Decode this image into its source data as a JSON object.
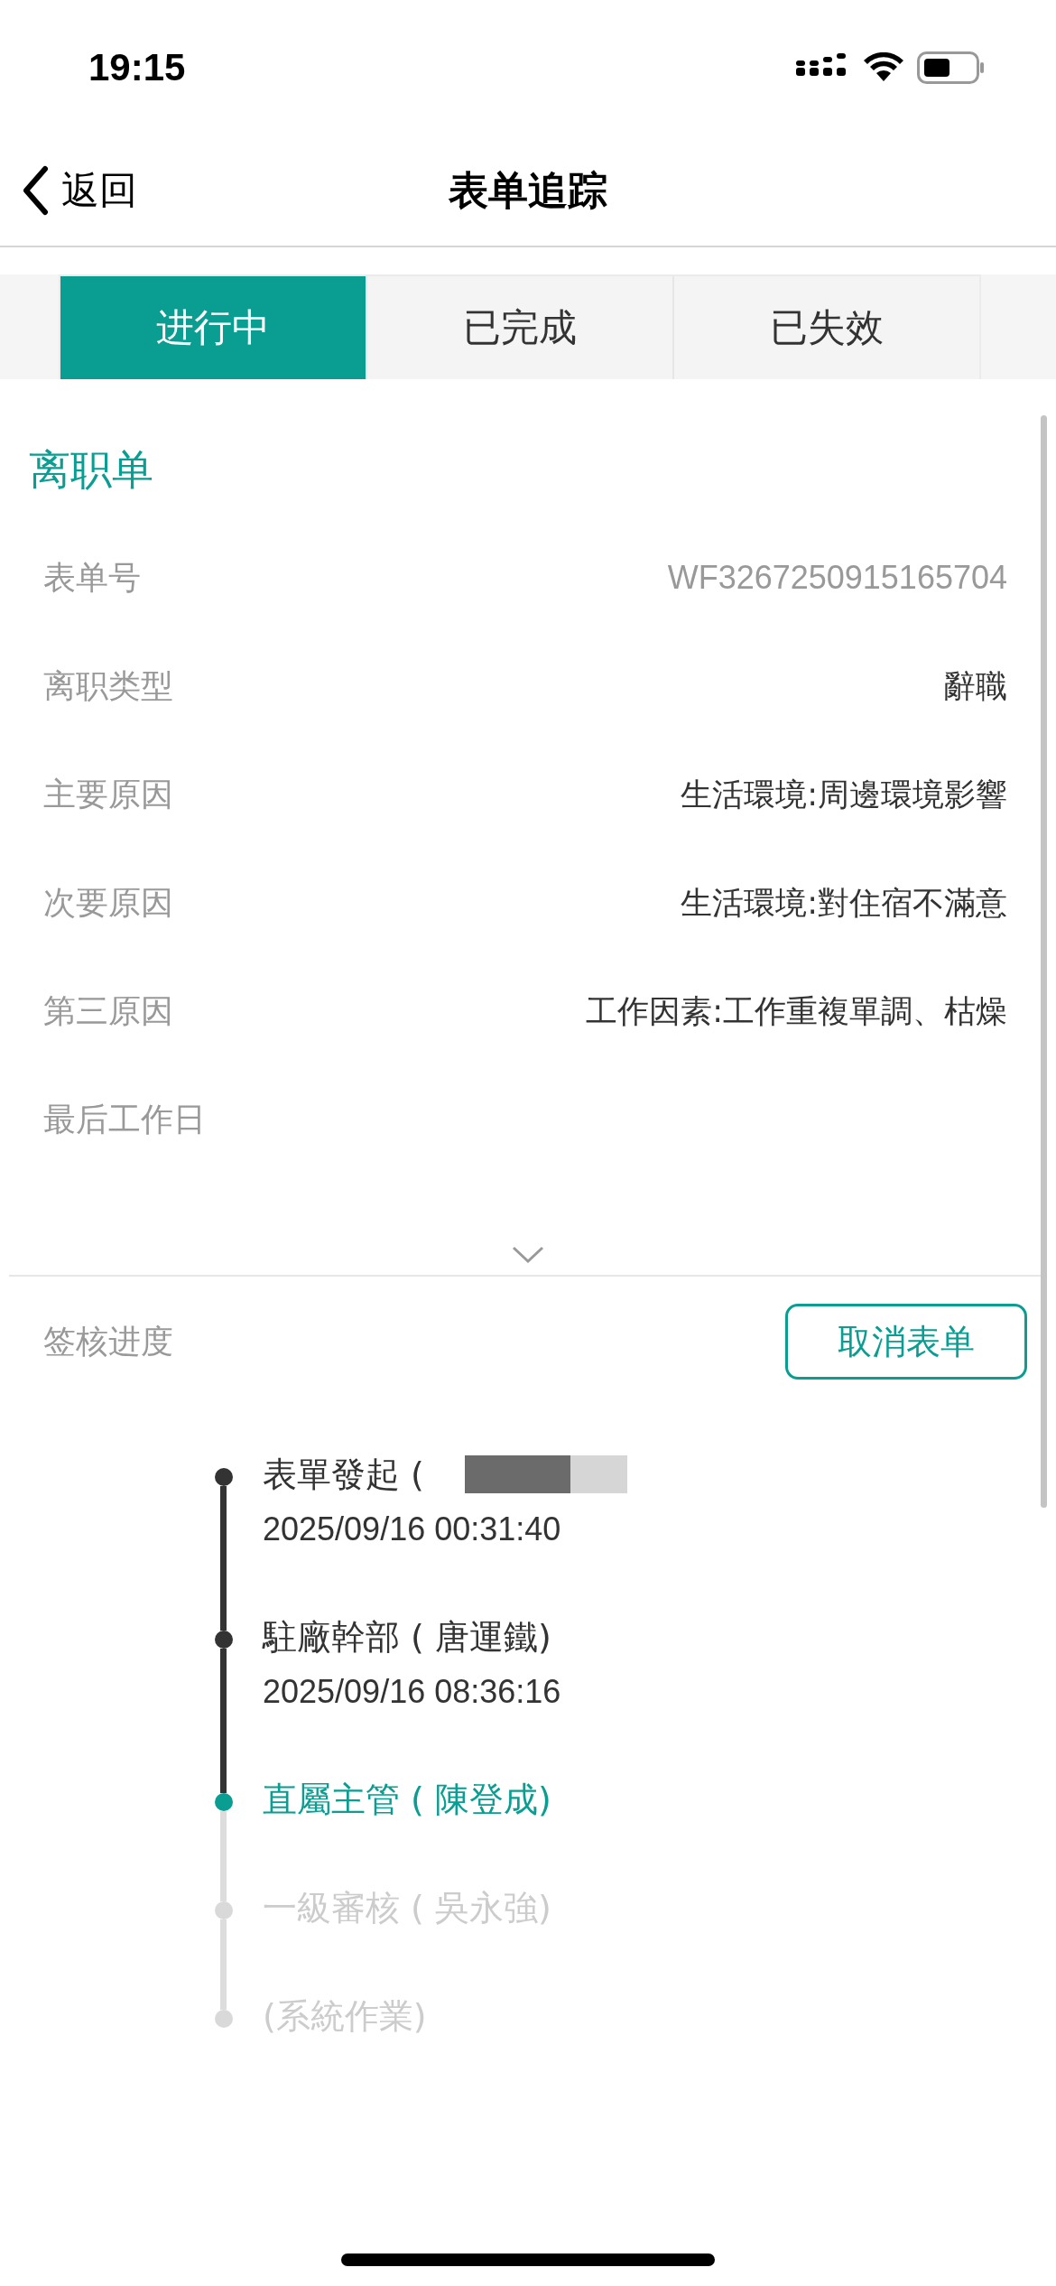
{
  "status_bar": {
    "time": "19:15"
  },
  "nav": {
    "back": "返回",
    "title": "表单追踪"
  },
  "tabs": [
    {
      "label": "进行中",
      "selected": true
    },
    {
      "label": "已完成",
      "selected": false
    },
    {
      "label": "已失效",
      "selected": false
    }
  ],
  "form": {
    "title": "离职单",
    "fields": [
      {
        "label": "表单号",
        "value": "WF3267250915165704",
        "kind": "code"
      },
      {
        "label": "离职类型",
        "value": "辭職",
        "kind": "text"
      },
      {
        "label": "主要原因",
        "value": "生活環境:周邊環境影響",
        "kind": "text"
      },
      {
        "label": "次要原因",
        "value": "生活環境:對住宿不滿意",
        "kind": "text"
      },
      {
        "label": "第三原因",
        "value": "工作因素:工作重複單調、枯燥",
        "kind": "text"
      },
      {
        "label": "最后工作日"
      }
    ],
    "progress_label": "签核进度",
    "cancel_button": "取消表单",
    "timeline": [
      {
        "step": "表單發起 (",
        "time": "2025/09/16 00:31:40",
        "kind": "done",
        "redacted": true
      },
      {
        "step": "駐廠幹部 ( 唐運鐵)",
        "time": "2025/09/16 08:36:16",
        "kind": "done"
      },
      {
        "step": "直屬主管 ( 陳登成)",
        "kind": "current"
      },
      {
        "step": "一級審核 ( 吳永強)",
        "kind": "pending"
      },
      {
        "step": "(系統作業)",
        "kind": "pending"
      }
    ]
  }
}
